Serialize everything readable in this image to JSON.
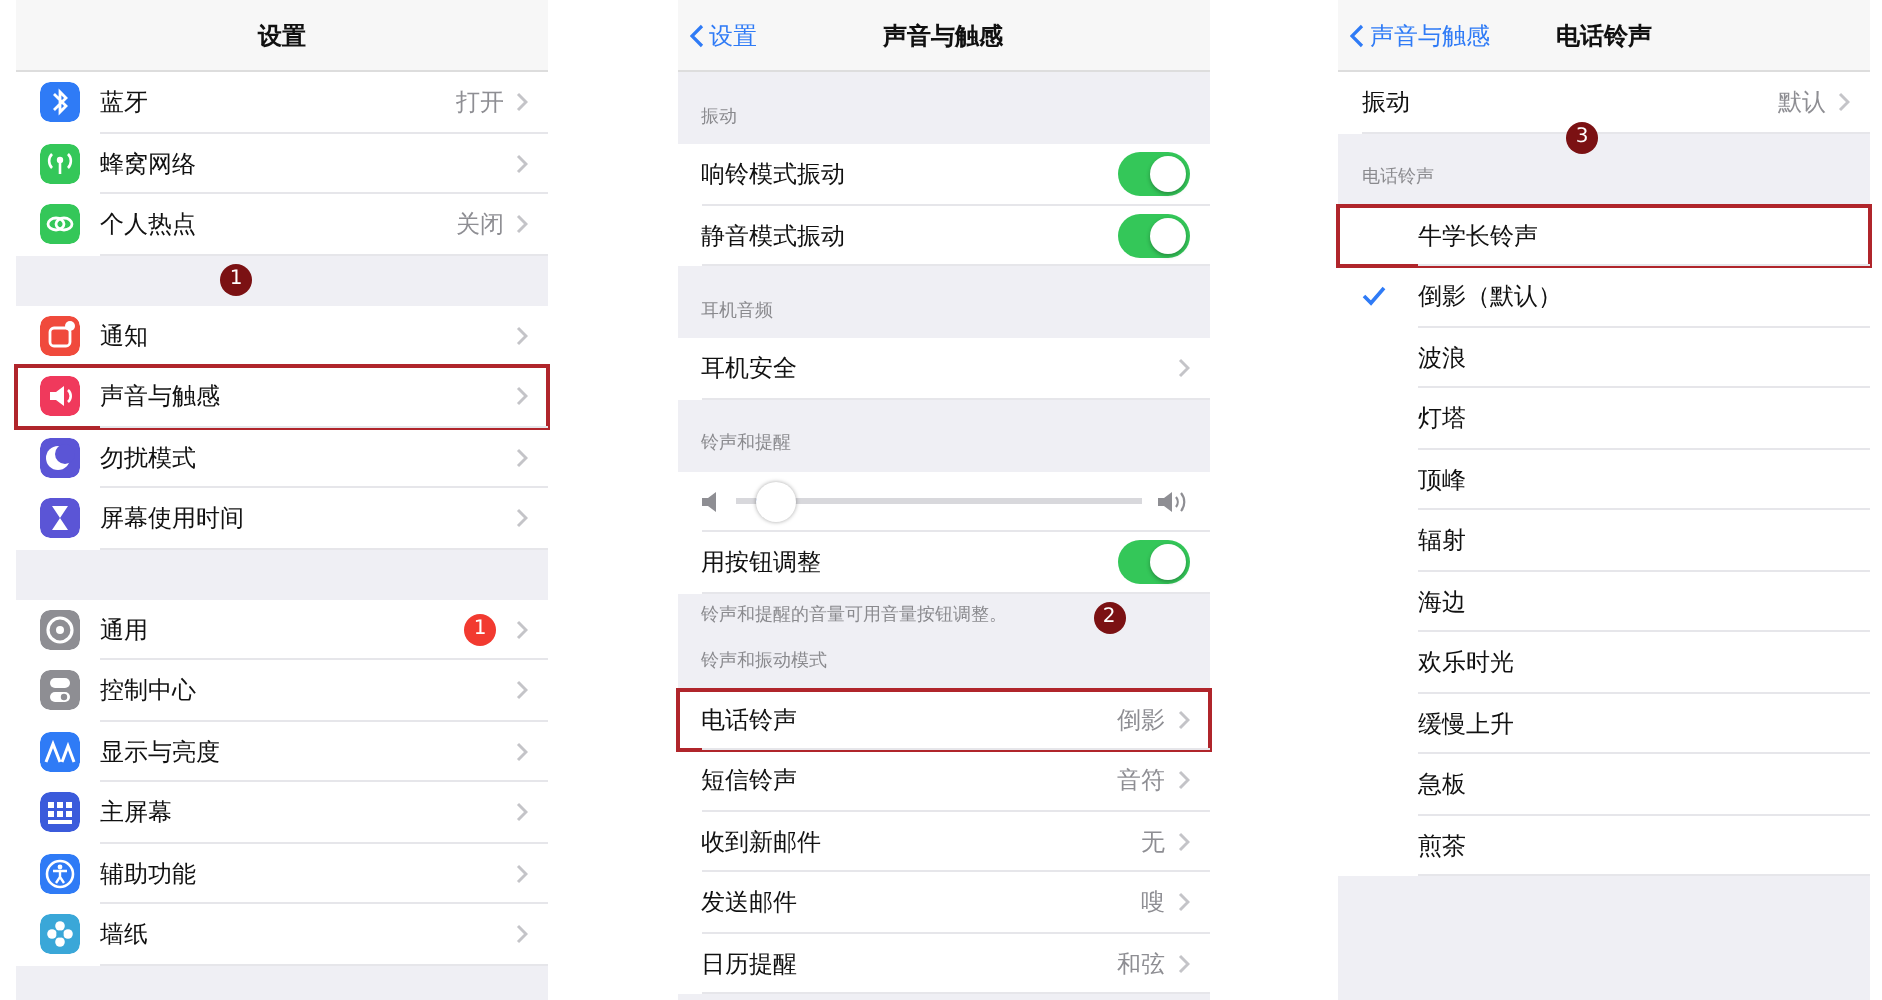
{
  "panels": [
    {
      "nav": {
        "title": "设置"
      },
      "rows": [
        {
          "kind": "item",
          "label": "蓝牙",
          "value": "打开",
          "color": "#2f7bf6"
        },
        {
          "kind": "item",
          "label": "蜂窝网络",
          "color": "#34c759"
        },
        {
          "kind": "item",
          "label": "个人热点",
          "value": "关闭",
          "color": "#34c759"
        },
        {
          "kind": "gap",
          "marker": "1"
        },
        {
          "kind": "item",
          "label": "通知",
          "color": "#f04a3c"
        },
        {
          "kind": "item",
          "label": "声音与触感",
          "color": "#f0395c",
          "highlighted": true
        },
        {
          "kind": "item",
          "label": "勿扰模式",
          "color": "#5b55d6"
        },
        {
          "kind": "item",
          "label": "屏幕使用时间",
          "color": "#5b55d6"
        },
        {
          "kind": "gap"
        },
        {
          "kind": "item",
          "label": "通用",
          "badge": "1",
          "color": "#8e8e93"
        },
        {
          "kind": "item",
          "label": "控制中心",
          "color": "#8e8e93"
        },
        {
          "kind": "item",
          "label": "显示与亮度",
          "color": "#2f7bf6"
        },
        {
          "kind": "item",
          "label": "主屏幕",
          "color": "#3b5bdb"
        },
        {
          "kind": "item",
          "label": "辅助功能",
          "color": "#2f7bf6"
        },
        {
          "kind": "item",
          "label": "墙纸",
          "color": "#3aa7d8"
        }
      ]
    },
    {
      "nav": {
        "back": "设置",
        "title": "声音与触感"
      },
      "rows": [
        {
          "kind": "header",
          "label": "振动"
        },
        {
          "kind": "toggle",
          "label": "响铃模式振动",
          "on": true
        },
        {
          "kind": "toggle",
          "label": "静音模式振动",
          "on": true
        },
        {
          "kind": "header",
          "label": "耳机音频"
        },
        {
          "kind": "item",
          "label": "耳机安全"
        },
        {
          "kind": "header",
          "label": "铃声和提醒"
        },
        {
          "kind": "slider",
          "level": 0.06
        },
        {
          "kind": "toggle",
          "label": "用按钮调整",
          "on": true
        },
        {
          "kind": "footer",
          "label": "铃声和提醒的音量可用音量按钮调整。",
          "marker": "2"
        },
        {
          "kind": "header",
          "label": "铃声和振动模式"
        },
        {
          "kind": "item",
          "label": "电话铃声",
          "value": "倒影",
          "highlighted": true
        },
        {
          "kind": "item",
          "label": "短信铃声",
          "value": "音符"
        },
        {
          "kind": "item",
          "label": "收到新邮件",
          "value": "无"
        },
        {
          "kind": "item",
          "label": "发送邮件",
          "value": "嗖"
        },
        {
          "kind": "item",
          "label": "日历提醒",
          "value": "和弦"
        }
      ]
    },
    {
      "nav": {
        "back": "声音与触感",
        "title": "电话铃声"
      },
      "rows": [
        {
          "kind": "item",
          "label": "振动",
          "value": "默认"
        },
        {
          "kind": "header",
          "label": "电话铃声",
          "marker": "3"
        },
        {
          "kind": "check",
          "label": "牛学长铃声",
          "selected": false,
          "highlighted": true
        },
        {
          "kind": "check",
          "label": "倒影（默认）",
          "selected": true
        },
        {
          "kind": "check",
          "label": "波浪",
          "selected": false
        },
        {
          "kind": "check",
          "label": "灯塔",
          "selected": false
        },
        {
          "kind": "check",
          "label": "顶峰",
          "selected": false
        },
        {
          "kind": "check",
          "label": "辐射",
          "selected": false
        },
        {
          "kind": "check",
          "label": "海边",
          "selected": false
        },
        {
          "kind": "check",
          "label": "欢乐时光",
          "selected": false
        },
        {
          "kind": "check",
          "label": "缓慢上升",
          "selected": false
        },
        {
          "kind": "check",
          "label": "急板",
          "selected": false
        },
        {
          "kind": "check",
          "label": "煎茶",
          "selected": false
        }
      ]
    }
  ]
}
